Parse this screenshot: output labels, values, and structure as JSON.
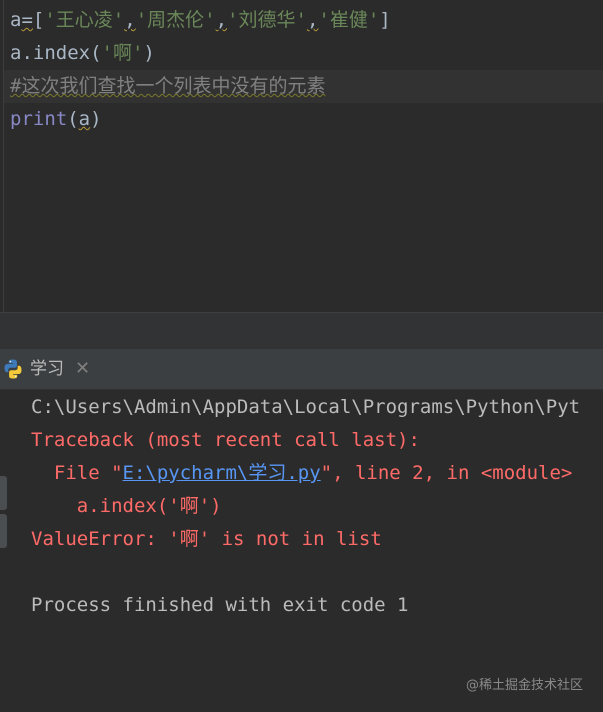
{
  "editor": {
    "lines": [
      {
        "prefix": "a",
        "eq": "=",
        "open": "[",
        "s1": "'王心凌'",
        "c1": ",",
        "s2": "'周杰伦'",
        "c2": ",",
        "s3": "'刘德华'",
        "c3": ",",
        "s4": "'崔健'",
        "close": "]"
      },
      {
        "obj": "a.index(",
        "arg": "'啊'",
        "end": ")"
      },
      {
        "comment": "#这次我们查找一个列表中没有的元素"
      },
      {
        "fn": "print",
        "open": "(",
        "arg": "a",
        "close": ")"
      }
    ]
  },
  "run_panel": {
    "tab_label": "学习",
    "close_glyph": "✕"
  },
  "console": {
    "cmd_line": "C:\\Users\\Admin\\AppData\\Local\\Programs\\Python\\Pyt",
    "traceback_header": "Traceback (most recent call last):",
    "file_prefix": "  File \"",
    "file_link": "E:\\pycharm\\学习.py",
    "file_suffix": "\", line 2, in <module>",
    "code_line": "    a.index('啊')",
    "error_line": "ValueError: '啊' is not in list",
    "exit_line": "Process finished with exit code 1"
  },
  "watermark": "@稀土掘金技术社区",
  "colors": {
    "background": "#2b2b2b",
    "string": "#6a8759",
    "builtin": "#8888c6",
    "error": "#ff6b68",
    "link": "#5896f5"
  }
}
